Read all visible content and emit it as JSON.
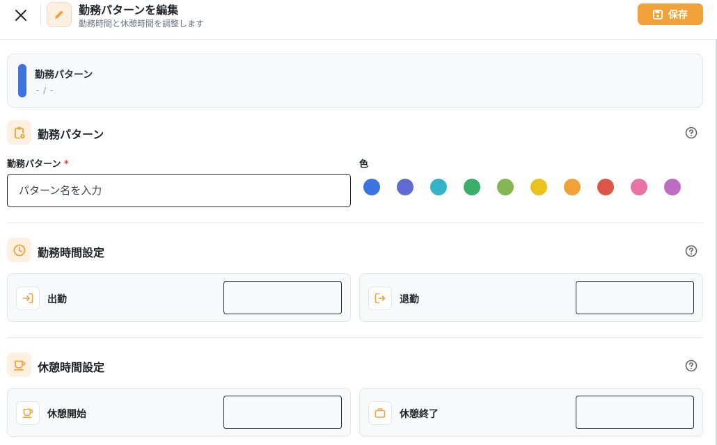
{
  "header": {
    "title": "勤務パターンを編集",
    "subtitle": "勤務時間と休憩時間を調整します",
    "save_label": "保存"
  },
  "summary": {
    "name": "勤務パターン",
    "time": "- / -",
    "color": "#3b73e0"
  },
  "pattern_section": {
    "title": "勤務パターン",
    "name_label": "勤務パターン",
    "required_mark": "*",
    "name_placeholder": "パターン名を入力",
    "name_value": "",
    "color_label": "色",
    "colors": [
      "#3b73e0",
      "#5f6bd1",
      "#35b3c6",
      "#3aae68",
      "#84b752",
      "#e9c21b",
      "#f2a139",
      "#dc5547",
      "#e873a6",
      "#bd6cc3"
    ]
  },
  "work_time_section": {
    "title": "勤務時間設定",
    "clock_in_label": "出勤",
    "clock_in_value": "",
    "clock_out_label": "退勤",
    "clock_out_value": ""
  },
  "break_section": {
    "title": "休憩時間設定",
    "break_start_label": "休憩開始",
    "break_start_value": "",
    "break_end_label": "休憩終了",
    "break_end_value": ""
  },
  "icons": {
    "accent": "#f2a139",
    "header": [
      "close-icon",
      "pencil-icon",
      "save-icon"
    ],
    "sections": [
      "clipboard-clock-icon",
      "clock-icon",
      "coffee-cup-icon",
      "help-circle-icon"
    ],
    "fields": [
      "login-icon",
      "logout-icon",
      "coffee-cup-icon",
      "briefcase-icon"
    ]
  }
}
